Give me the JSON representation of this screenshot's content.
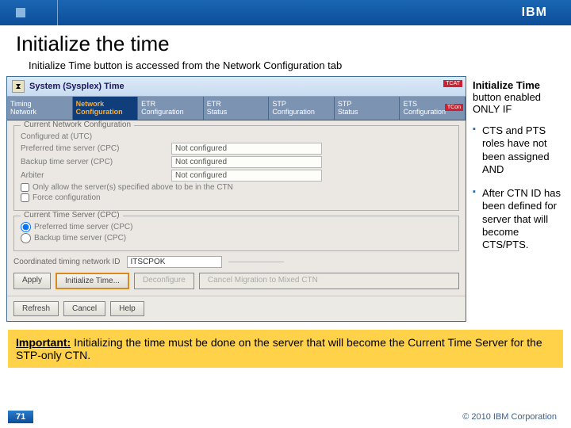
{
  "header": {
    "logo_text": "IBM"
  },
  "slide": {
    "title": "Initialize the time",
    "subtitle": "Initialize Time button is accessed from the Network Configuration tab"
  },
  "window": {
    "title": "System (Sysplex) Time",
    "badge_top": "TCAT",
    "badge_body": "TCon",
    "tabs": [
      {
        "line1": "Timing",
        "line2": "Network"
      },
      {
        "line1": "Network",
        "line2": "Configuration"
      },
      {
        "line1": "ETR",
        "line2": "Configuration"
      },
      {
        "line1": "ETR",
        "line2": "Status"
      },
      {
        "line1": "STP",
        "line2": "Configuration"
      },
      {
        "line1": "STP",
        "line2": "Status"
      },
      {
        "line1": "ETS",
        "line2": "Configuration"
      }
    ],
    "group1": {
      "title": "Current Network Configuration",
      "rows": [
        {
          "label": "Configured at (UTC)",
          "value": ""
        },
        {
          "label": "Preferred time server (CPC)",
          "value": "Not configured"
        },
        {
          "label": "Backup time server (CPC)",
          "value": "Not configured"
        },
        {
          "label": "Arbiter",
          "value": "Not configured"
        }
      ],
      "check1": "Only allow the server(s) specified above to be in the CTN",
      "check2": "Force configuration"
    },
    "group2": {
      "title": "Current Time Server (CPC)",
      "radio1": "Preferred time server (CPC)",
      "radio2": "Backup time server (CPC)"
    },
    "ctn_label": "Coordinated timing network ID",
    "ctn_value": "ITSCPOK",
    "buttons": {
      "apply": "Apply",
      "init": "Initialize Time...",
      "deconfig": "Deconfigure",
      "cancel_mig": "Cancel Migration to Mixed CTN"
    },
    "bottom": {
      "refresh": "Refresh",
      "cancel": "Cancel",
      "help": "Help"
    }
  },
  "side": {
    "header_line1": "Initialize Time",
    "header_line2": "button enabled",
    "header_line3": "ONLY IF",
    "bullets": [
      "CTS and PTS roles have not been assigned AND",
      "After CTN ID has been defined for server that will become CTS/PTS."
    ]
  },
  "important": {
    "label": "Important:",
    "text": " Initializing the time must be done on the server that will become the Current Time Server for the STP-only CTN."
  },
  "footer": {
    "page": "71",
    "copyright": "© 2010 IBM Corporation"
  }
}
